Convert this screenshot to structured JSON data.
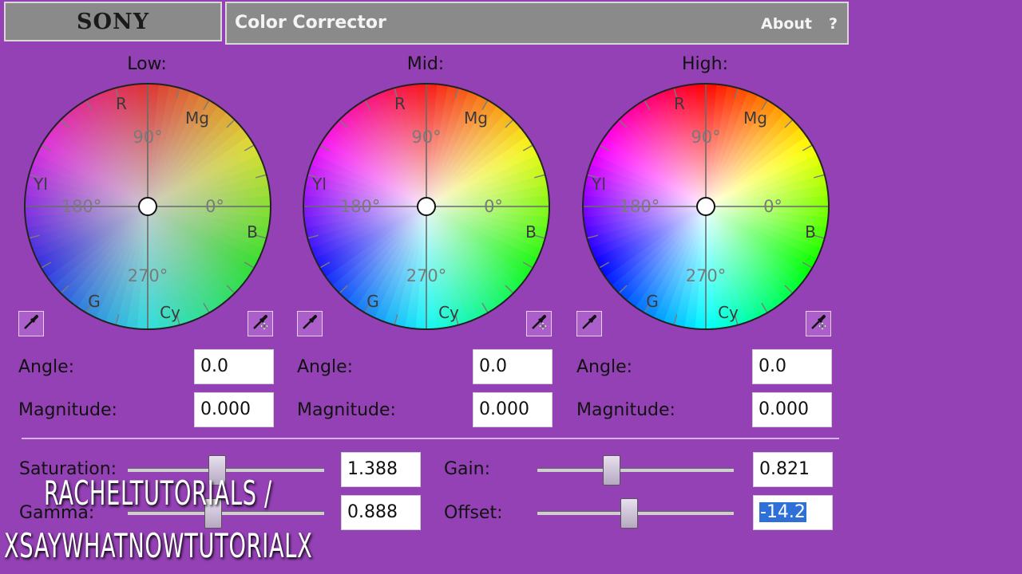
{
  "app": {
    "brand": "SONY",
    "title": "Color Corrector",
    "about": "About",
    "help": "?"
  },
  "wheels": {
    "axis": {
      "r": "R",
      "mg": "Mg",
      "yl": "Yl",
      "b": "B",
      "g": "G",
      "cy": "Cy",
      "deg90": "90°",
      "deg180": "180°",
      "deg0": "0°",
      "deg270": "270°"
    },
    "low": {
      "label": "Low:",
      "angle_label": "Angle:",
      "angle": "0.0",
      "magnitude_label": "Magnitude:",
      "magnitude": "0.000"
    },
    "mid": {
      "label": "Mid:",
      "angle_label": "Angle:",
      "angle": "0.0",
      "magnitude_label": "Magnitude:",
      "magnitude": "0.000"
    },
    "high": {
      "label": "High:",
      "angle_label": "Angle:",
      "angle": "0.0",
      "magnitude_label": "Magnitude:",
      "magnitude": "0.000"
    }
  },
  "sliders": {
    "saturation": {
      "label": "Saturation:",
      "value": "1.388"
    },
    "gamma": {
      "label": "Gamma:",
      "value": "0.888"
    },
    "gain": {
      "label": "Gain:",
      "value": "0.821"
    },
    "offset": {
      "label": "Offset:",
      "value": "-14.2"
    }
  },
  "watermark": {
    "line1": "RACHELTUTORIALS /",
    "line2": "XSAYWHATNOWTUTORIALX"
  },
  "icons": {
    "eyedropper": "eyedropper-icon"
  }
}
